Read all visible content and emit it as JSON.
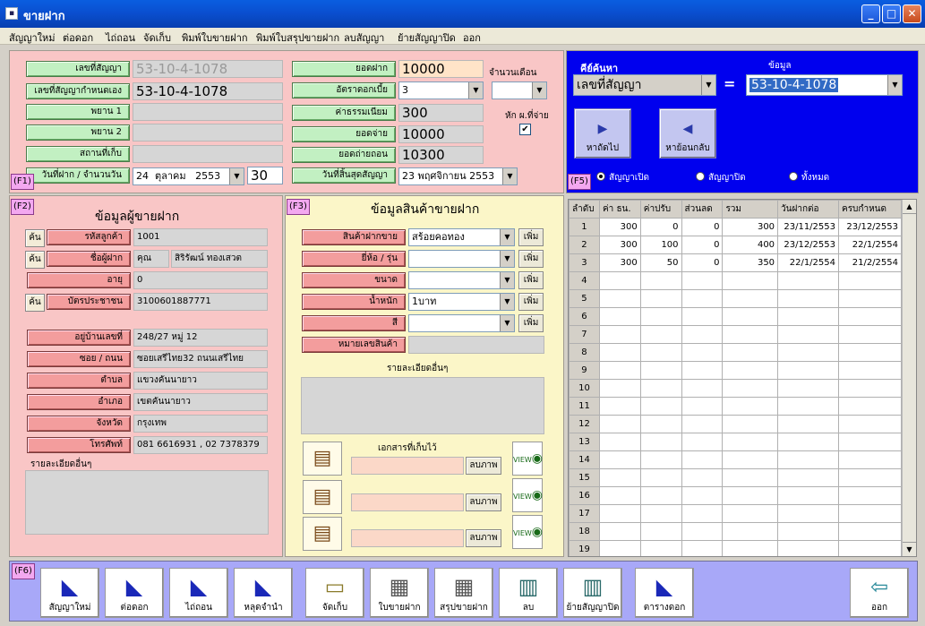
{
  "window": {
    "title": "ขายฝาก"
  },
  "menu": [
    "สัญญาใหม่",
    "ต่อดอก",
    "ไถ่ถอน",
    "จัดเก็บ",
    "พิมพ์ใบขายฝาก",
    "พิมพ์ใบสรุปขายฝาก",
    "ลบสัญญา",
    "ย้ายสัญญาปิด",
    "ออก"
  ],
  "contract": {
    "labels": {
      "no": "เลขที่สัญญา",
      "custom_no": "เลขที่สัญญากำหนดเอง",
      "witness1": "พยาน 1",
      "witness2": "พยาน 2",
      "location": "สถานที่เก็บ",
      "date_days": "วันที่ฝาก / จำนวนวัน"
    },
    "no": "53-10-4-1078",
    "custom_no": "53-10-4-1078",
    "witness1": "",
    "witness2": "",
    "location": "",
    "date_day": "24",
    "date_month": "ตุลาคม",
    "date_year": "2553",
    "days": "30"
  },
  "finance": {
    "labels": {
      "deposit": "ยอดฝาก",
      "rate": "อัตราดอกเบี้ย",
      "fee": "ค่าธรรมเนียม",
      "payout": "ยอดจ่าย",
      "redeem": "ยอดถ่ายถอน",
      "end_date": "วันที่สิ้นสุดสัญญา"
    },
    "deposit": "10000",
    "rate": "3",
    "fee": "300",
    "payout": "10000",
    "redeem": "10300",
    "end_date": "23 พฤศจิกายน 2553",
    "months_label": "จำนวนเดือน",
    "deduct_label": "หัก ผ.ที่จ่าย",
    "deduct_checked": "✔"
  },
  "search": {
    "title": "คีย์ค้นหา",
    "data_label": "ข้อมูล",
    "field": "เลขที่สัญญา",
    "equals": "=",
    "value": "53-10-4-1078",
    "next": "หาถัดไป",
    "prev": "หาย้อนกลับ",
    "filters": [
      "สัญญาเปิด",
      "สัญญาปิด",
      "ทั้งหมด"
    ]
  },
  "tags": {
    "f1": "(F1)",
    "f2": "(F2)",
    "f3": "(F3)",
    "f5": "(F5)",
    "f6": "(F6)"
  },
  "customer": {
    "section_title": "ข้อมูลผู้ขายฝาก",
    "search_btn": "ค้น",
    "labels": {
      "code": "รหัสลูกค้า",
      "name": "ชื่อผู้ฝาก",
      "age": "อายุ",
      "id_card": "บัตรประชาชน",
      "house_no": "อยู่บ้านเลขที่",
      "street": "ซอย / ถนน",
      "sub_district": "ตำบล",
      "district": "อำเภอ",
      "province": "จังหวัด",
      "phone": "โทรศัพท์",
      "other": "รายละเอียดอื่นๆ"
    },
    "code": "1001",
    "prefix": "คุณ",
    "name": "สิริรัฒน์ ทองเสวต",
    "age": "0",
    "id_card": "3100601887771",
    "house_no": "248/27 หมู่ 12",
    "street": "ซอยเสรีไทย32 ถนนเสรีไทย",
    "sub_district": "แขวงคันนายาว",
    "district": "เขตคันนายาว",
    "province": "กรุงเทพ",
    "phone": "081 6616931 , 02 7378379"
  },
  "product": {
    "section_title": "ข้อมูลสินค้าขายฝาก",
    "add_btn": "เพิ่ม",
    "labels": {
      "item": "สินค้าฝากขาย",
      "brand": "ยี่ห้อ / รุ่น",
      "size": "ขนาด",
      "weight": "น้ำหนัก",
      "color": "สี",
      "serial": "หมายเลขสินค้า",
      "other": "รายละเอียดอื่นๆ",
      "docs": "เอกสารที่เก็บไว้",
      "del_img": "ลบภาพ",
      "view": "VIEW"
    },
    "item": "สร้อยคอทอง",
    "brand": "",
    "size": "",
    "weight": "1บาท",
    "color": "",
    "serial": ""
  },
  "grid": {
    "headers": [
      "ลำดับ",
      "ค่า ธน.",
      "ค่าปรับ",
      "ส่วนลด",
      "รวม",
      "วันฝากต่อ",
      "ครบกำหนด"
    ],
    "rows": [
      [
        "1",
        "300",
        "0",
        "0",
        "300",
        "23/11/2553",
        "23/12/2553"
      ],
      [
        "2",
        "300",
        "100",
        "0",
        "400",
        "23/12/2553",
        "22/1/2554"
      ],
      [
        "3",
        "300",
        "50",
        "0",
        "350",
        "22/1/2554",
        "21/2/2554"
      ],
      [
        "4",
        "",
        "",
        "",
        "",
        "",
        ""
      ],
      [
        "5",
        "",
        "",
        "",
        "",
        "",
        ""
      ],
      [
        "6",
        "",
        "",
        "",
        "",
        "",
        ""
      ],
      [
        "7",
        "",
        "",
        "",
        "",
        "",
        ""
      ],
      [
        "8",
        "",
        "",
        "",
        "",
        "",
        ""
      ],
      [
        "9",
        "",
        "",
        "",
        "",
        "",
        ""
      ],
      [
        "10",
        "",
        "",
        "",
        "",
        "",
        ""
      ],
      [
        "11",
        "",
        "",
        "",
        "",
        "",
        ""
      ],
      [
        "12",
        "",
        "",
        "",
        "",
        "",
        ""
      ],
      [
        "13",
        "",
        "",
        "",
        "",
        "",
        ""
      ],
      [
        "14",
        "",
        "",
        "",
        "",
        "",
        ""
      ],
      [
        "15",
        "",
        "",
        "",
        "",
        "",
        ""
      ],
      [
        "16",
        "",
        "",
        "",
        "",
        "",
        ""
      ],
      [
        "17",
        "",
        "",
        "",
        "",
        "",
        ""
      ],
      [
        "18",
        "",
        "",
        "",
        "",
        "",
        ""
      ],
      [
        "19",
        "",
        "",
        "",
        "",
        "",
        ""
      ]
    ]
  },
  "toolbar": [
    "สัญญาใหม่",
    "ต่อดอก",
    "ไถ่ถอน",
    "หลุดจำนำ",
    "จัดเก็บ",
    "ใบขายฝาก",
    "สรุปขายฝาก",
    "ลบ",
    "ย้ายสัญญาปิด",
    "ตารางดอก",
    "ออก"
  ]
}
